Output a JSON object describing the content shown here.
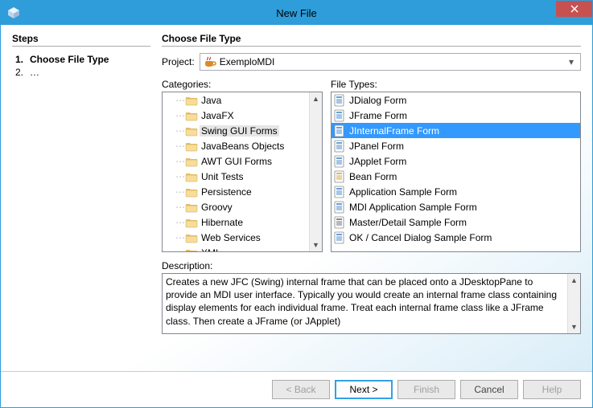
{
  "window": {
    "title": "New File"
  },
  "sidebar": {
    "heading": "Steps",
    "steps": [
      {
        "num": "1.",
        "label": "Choose File Type",
        "bold": true
      },
      {
        "num": "2.",
        "label": "…",
        "bold": false
      }
    ]
  },
  "main": {
    "heading": "Choose File Type",
    "project_label": "Project:",
    "project_value": "ExemploMDI",
    "categories_label": "Categories:",
    "categories": [
      "Java",
      "JavaFX",
      "Swing GUI Forms",
      "JavaBeans Objects",
      "AWT GUI Forms",
      "Unit Tests",
      "Persistence",
      "Groovy",
      "Hibernate",
      "Web Services",
      "XML"
    ],
    "categories_selected_index": 2,
    "filetypes_label": "File Types:",
    "filetypes": [
      "JDialog Form",
      "JFrame Form",
      "JInternalFrame Form",
      "JPanel Form",
      "JApplet Form",
      "Bean Form",
      "Application Sample Form",
      "MDI Application Sample Form",
      "Master/Detail Sample Form",
      "OK / Cancel Dialog Sample Form"
    ],
    "filetypes_selected_index": 2,
    "description_label": "Description:",
    "description_text": "Creates a new JFC (Swing) internal frame that can be placed onto a JDesktopPane to provide an MDI user interface. Typically you would create an internal frame class containing display elements for each individual frame. Treat each internal frame class like a JFrame class. Then create a JFrame (or JApplet)"
  },
  "footer": {
    "back": "< Back",
    "next": "Next >",
    "finish": "Finish",
    "cancel": "Cancel",
    "help": "Help"
  }
}
